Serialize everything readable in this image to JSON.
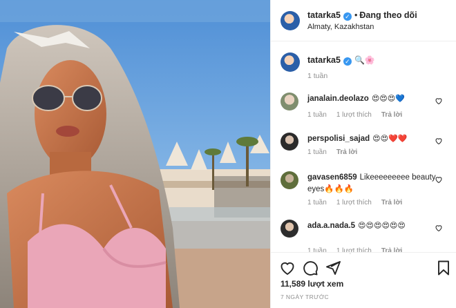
{
  "post": {
    "username": "tatarka5",
    "follow_separator": "•",
    "follow_state": "Đang theo dõi",
    "location": "Almaty, Kazakhstan"
  },
  "caption": {
    "username": "tatarka5",
    "emojis": "🔍🌸",
    "time": "1 tuần"
  },
  "comments": [
    {
      "username": "janalain.deolazo",
      "text": "😍😍😍💙",
      "time": "1 tuần",
      "likes": "1 lượt thích",
      "reply": "Trả lời"
    },
    {
      "username": "perspolisi_sajad",
      "text": "😍😍❤️❤️",
      "time": "1 tuần",
      "likes": "",
      "reply": "Trả lời"
    },
    {
      "username": "gavasen6859",
      "text": "Likeeeeeeeee beauty eyes🔥🔥🔥",
      "time": "1 tuần",
      "likes": "1 lượt thích",
      "reply": "Trả lời"
    },
    {
      "username": "ada.a.nada.5",
      "text": "😍😍😍😍😍😍",
      "time": "1 tuần",
      "likes": "1 lượt thích",
      "reply": "Trả lời"
    }
  ],
  "stats": {
    "views": "11,589 lượt xem",
    "posted": "7 NGÀY TRƯỚC"
  },
  "icons": {
    "like": "heart-icon",
    "comment": "comment-icon",
    "share": "share-icon",
    "save": "bookmark-icon"
  },
  "colors": {
    "verified": "#3897f0",
    "muted": "#8e8e8e",
    "text": "#262626"
  }
}
